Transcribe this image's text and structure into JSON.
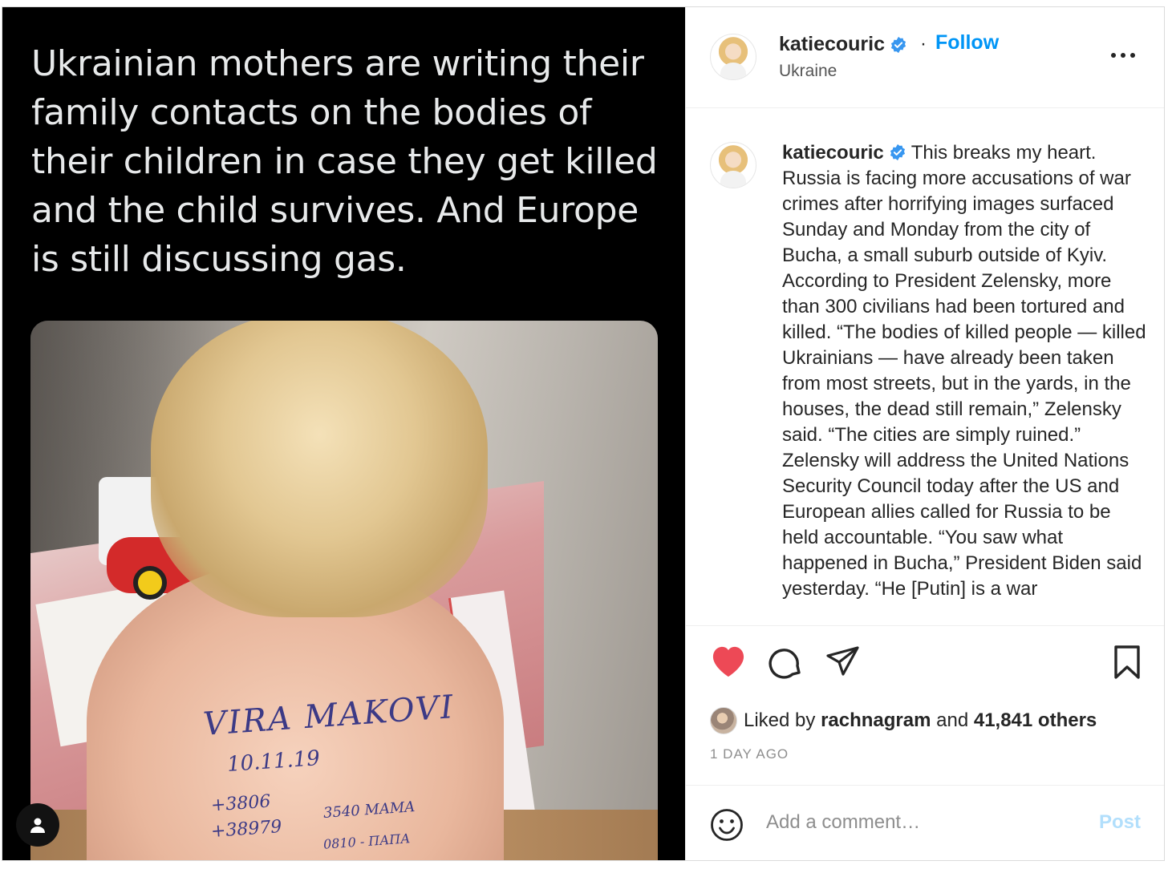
{
  "tweet": {
    "text": "Ukrainian mothers are writing their family contacts on the bodies of their children in case they get killed and the child survives. And Europe is still discussing gas."
  },
  "photo": {
    "ink_line1": "VIRA MAKOVI",
    "ink_line2": "10.11.19",
    "ink_line3": "+3806",
    "ink_line4": "+38979",
    "ink_line5": "3540 MAMA",
    "ink_line6": "0810 - ПАПА"
  },
  "post": {
    "username": "katiecouric",
    "follow_label": "Follow",
    "separator": "·",
    "location": "Ukraine",
    "caption": "This breaks my heart. Russia is facing more accusations of war crimes after horrifying images surfaced Sunday and Monday from the city of Bucha, a small suburb outside of Kyiv. According to President Zelensky, more than 300 civilians had been tortured and killed. “The bodies of killed people — killed Ukrainians — have already been taken from most streets, but in the yards, in the houses, the dead still remain,” Zelensky said. “The cities are simply ruined.” Zelensky will address the United Nations Security Council today after the US and European allies called for Russia to be held accountable. “You saw what happened in Bucha,” President Biden said yesterday. “He [Putin] is a war",
    "likes_prefix": "Liked by",
    "liked_by_user": "rachnagram",
    "likes_and": "and",
    "likes_others": "41,841 others",
    "timestamp": "1 DAY AGO",
    "comment_placeholder": "Add a comment…",
    "post_label": "Post"
  },
  "colors": {
    "accent": "#0095f6",
    "like_red": "#ed4956",
    "post_disabled": "#b2dffc",
    "verified": "#3897f0"
  },
  "icons": {
    "like": "heart-icon",
    "comment": "comment-icon",
    "share": "paper-plane-icon",
    "save": "bookmark-icon",
    "emoji": "smiley-icon",
    "more": "ellipsis-icon",
    "verified": "verified-badge-icon",
    "user_tag": "user-tag-icon"
  }
}
